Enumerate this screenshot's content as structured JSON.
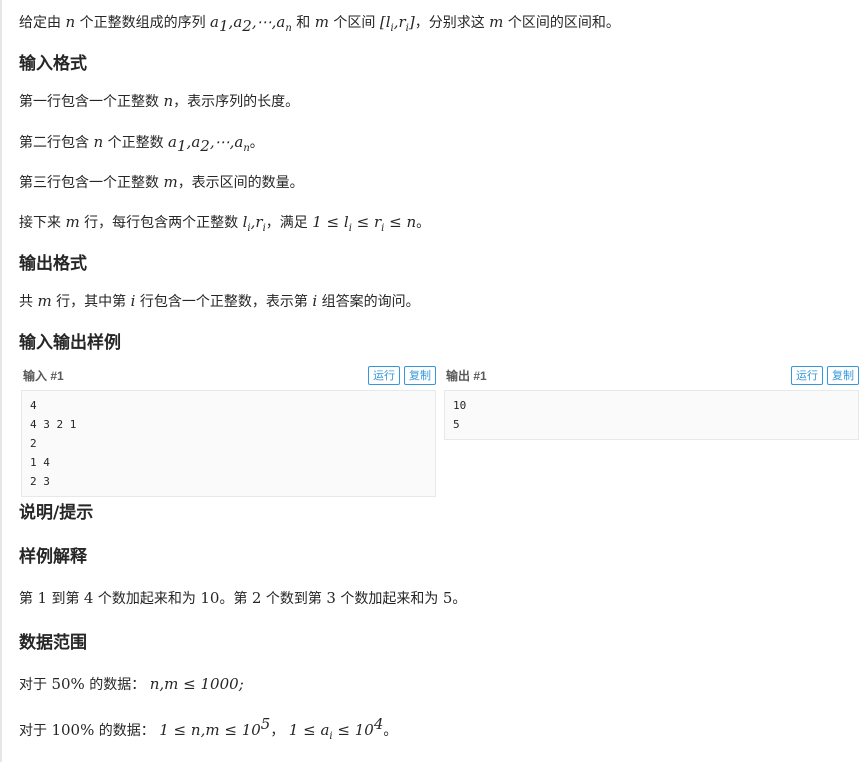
{
  "intro": {
    "p1": "给定由",
    "m1": "n",
    "p2": "个正整数组成的序列",
    "m2": "a",
    "s2": "1",
    "m3": "a",
    "s3": "2",
    "dots": "⋯",
    "m4": "a",
    "s4": "n",
    "p3": "和",
    "m5": "m",
    "p4": "个区间",
    "m6": "l",
    "s6": "i",
    "m7": "r",
    "s7": "i",
    "p5": "，分别求这",
    "m8": "m",
    "p6": "个区间的区间和。"
  },
  "input_format": {
    "heading": "输入格式",
    "line1_a": "第一行包含一个正整数",
    "line1_m": "n",
    "line1_b": "，表示序列的长度。",
    "line2_a": "第二行包含",
    "line2_m": "n",
    "line2_b": "个正整数",
    "line2_end": "。",
    "line3_a": "第三行包含一个正整数",
    "line3_m": "m",
    "line3_b": "，表示区间的数量。",
    "line4_a": "接下来",
    "line4_m": "m",
    "line4_b": "行，每行包含两个正整数",
    "line4_c": "，满足",
    "line4_end": "。"
  },
  "output_format": {
    "heading": "输出格式",
    "a": "共",
    "m1": "m",
    "b": "行，其中第",
    "m2": "i",
    "c": "行包含一个正整数，表示第",
    "m3": "i",
    "d": "组答案的询问。"
  },
  "samples": {
    "heading": "输入输出样例",
    "input_title": "输入 #1",
    "output_title": "输出 #1",
    "run_label": "运行",
    "copy_label": "复制",
    "input_text": "4\n4 3 2 1\n2\n1 4\n2 3",
    "output_text": "10\n5"
  },
  "hint": {
    "heading": "说明/提示",
    "sample_heading": "样例解释",
    "sample_text_a": "第",
    "n1": "1",
    "sample_text_b": "到第",
    "n2": "4",
    "sample_text_c": "个数加起来和为",
    "n3": "10",
    "sample_text_d": "。第",
    "n4": "2",
    "sample_text_e": "个数到第",
    "n5": "3",
    "sample_text_f": "个数加起来和为",
    "n6": "5",
    "sample_text_g": "。",
    "range_heading": "数据范围",
    "range1_a": "对于",
    "range1_pct": "50%",
    "range1_b": "的数据：",
    "range1_lim": "1000",
    "range2_a": "对于",
    "range2_pct": "100%",
    "range2_b": "的数据：",
    "range2_exp1": "5",
    "range2_exp2": "4",
    "range2_end": "。"
  }
}
